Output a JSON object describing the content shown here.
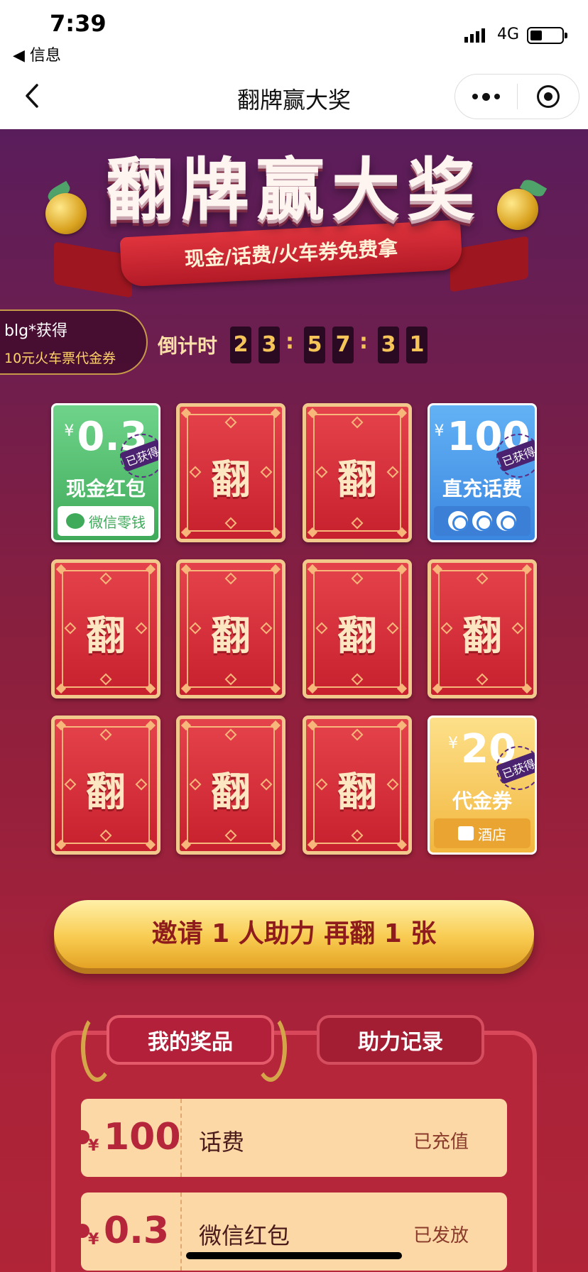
{
  "status_bar": {
    "time": "7:39",
    "back_app": "◀ 信息",
    "network": "4G"
  },
  "navbar": {
    "title": "翻牌赢大奖"
  },
  "banner": {
    "title": "翻牌赢大奖",
    "subtitle": "现金/话费/火车券免费拿"
  },
  "winner": {
    "user": "blg*获得",
    "prize": "10元火车票代金券"
  },
  "countdown": {
    "label": "倒计时",
    "digits": [
      "2",
      "3",
      "5",
      "7",
      "3",
      "1"
    ],
    "separator": ":"
  },
  "cards": [
    {
      "type": "prize",
      "color": "green",
      "currency": "¥",
      "amount": "0.3",
      "name": "现金红包",
      "footer": "微信零钱",
      "stamp": "已获得"
    },
    {
      "type": "back",
      "label": "翻"
    },
    {
      "type": "back",
      "label": "翻"
    },
    {
      "type": "prize",
      "color": "blue",
      "currency": "¥",
      "amount": "100",
      "name": "直充话费",
      "stamp": "已获得"
    },
    {
      "type": "back",
      "label": "翻"
    },
    {
      "type": "back",
      "label": "翻"
    },
    {
      "type": "back",
      "label": "翻"
    },
    {
      "type": "back",
      "label": "翻"
    },
    {
      "type": "back",
      "label": "翻"
    },
    {
      "type": "back",
      "label": "翻"
    },
    {
      "type": "back",
      "label": "翻"
    },
    {
      "type": "prize",
      "color": "gold",
      "currency": "¥",
      "amount": "20",
      "name": "代金券",
      "footer": "酒店",
      "stamp": "已获得"
    }
  ],
  "invite_button": "邀请 1 人助力 再翻 1 张",
  "tabs": {
    "my_prizes": "我的奖品",
    "help_records": "助力记录"
  },
  "prize_list": [
    {
      "currency": "¥",
      "amount": "100",
      "name": "话费",
      "status": "已充值"
    },
    {
      "currency": "¥",
      "amount": "0.3",
      "name": "微信红包",
      "status": "已发放"
    }
  ],
  "colors": {
    "card_red": "#c7202e",
    "gold": "#f8cb50",
    "panel": "#b5263a"
  }
}
